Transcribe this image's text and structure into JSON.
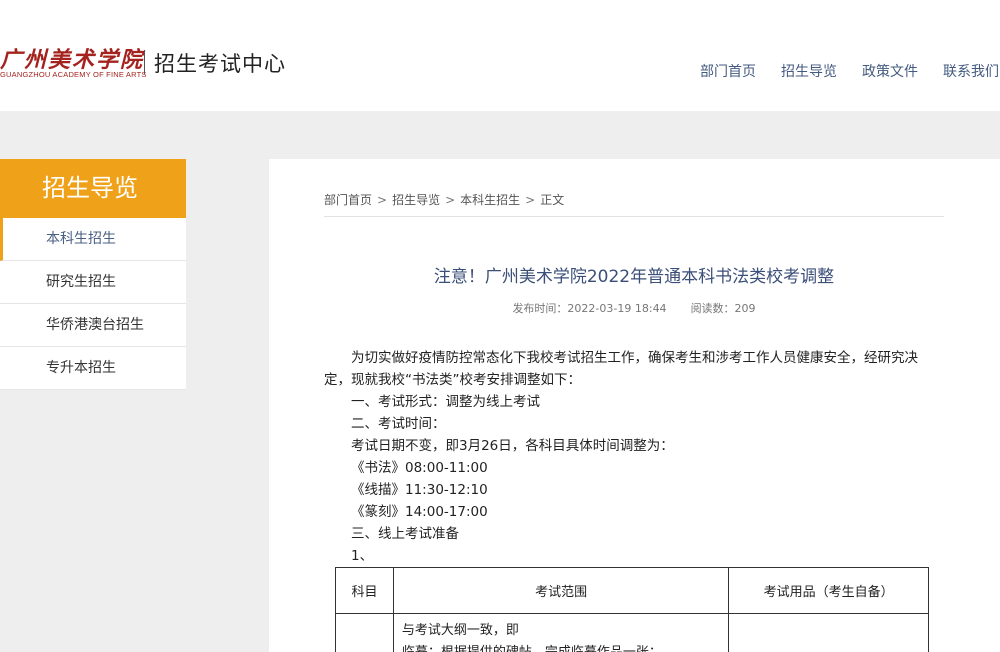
{
  "header": {
    "logo_cn": "广州美术学院",
    "logo_en": "GUANGZHOU ACADEMY OF FINE ARTS",
    "site_title": "招生考试中心",
    "nav": [
      "部门首页",
      "招生导览",
      "政策文件",
      "联系我们"
    ]
  },
  "sidebar": {
    "heading": "招生导览",
    "items": [
      {
        "label": "本科生招生",
        "active": true
      },
      {
        "label": "研究生招生",
        "active": false
      },
      {
        "label": "华侨港澳台招生",
        "active": false
      },
      {
        "label": "专升本招生",
        "active": false
      }
    ]
  },
  "breadcrumb": {
    "items": [
      "部门首页",
      "招生导览",
      "本科生招生",
      "正文"
    ],
    "separator": ">"
  },
  "article": {
    "title": "注意！广州美术学院2022年普通本科书法类校考调整",
    "publish_time": "发布时间：2022-03-19 18:44",
    "views": "阅读数：209",
    "paragraphs": [
      "为切实做好疫情防控常态化下我校考试招生工作，确保考生和涉考工作人员健康安全，经研究决定，现就我校“书法类”校考安排调整如下：",
      "一、考试形式：调整为线上考试",
      "二、考试时间：",
      "考试日期不变，即3月26日，各科目具体时间调整为：",
      "《书法》08:00-11:00",
      "《线描》11:30-12:10",
      "《篆刻》14:00-17:00",
      "三、线上考试准备",
      "1、"
    ],
    "table": {
      "headers": [
        "科目",
        "考试范围",
        "考试用品（考生自备）"
      ],
      "row1": {
        "subject": "",
        "scope": [
          "与考试大纲一致，即",
          "临摹：根据提供的碑帖，完成临摹作品一张；"
        ],
        "supplies": ""
      }
    }
  }
}
